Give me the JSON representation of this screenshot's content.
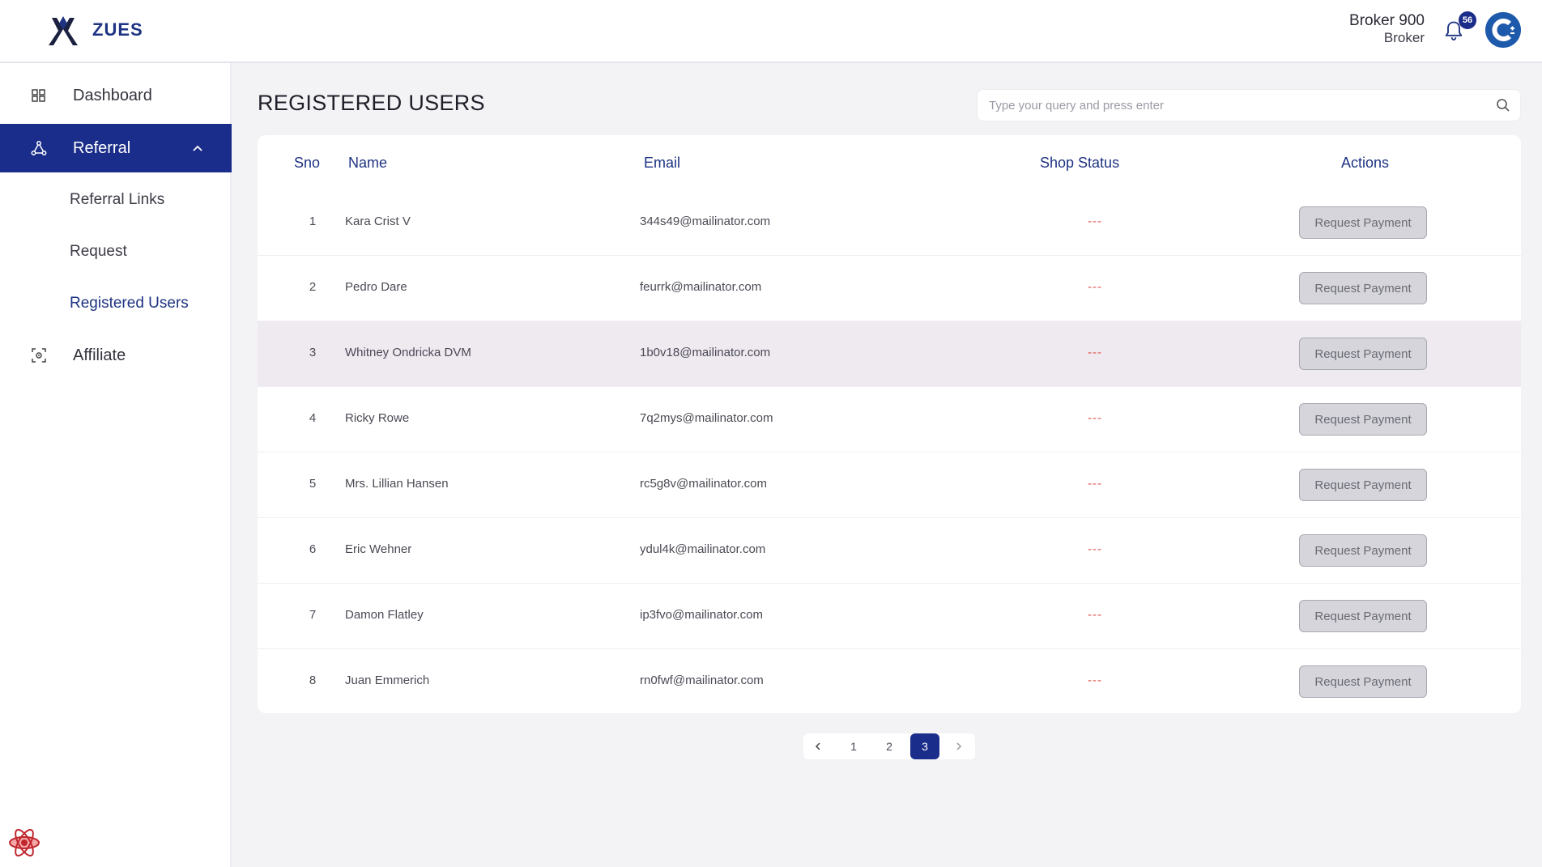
{
  "app": {
    "brand": "ZUES"
  },
  "user": {
    "name": "Broker 900",
    "role": "Broker",
    "notifications": "56"
  },
  "sidebar": {
    "items": [
      {
        "label": "Dashboard",
        "icon": "grid-icon"
      },
      {
        "label": "Referral",
        "icon": "referral-network-icon"
      },
      {
        "label": "Referral Links"
      },
      {
        "label": "Request"
      },
      {
        "label": "Registered Users"
      },
      {
        "label": "Affiliate",
        "icon": "affiliate-frame-icon"
      }
    ]
  },
  "page": {
    "title": "REGISTERED USERS"
  },
  "search": {
    "placeholder": "Type your query and press enter"
  },
  "table": {
    "headers": {
      "sno": "Sno",
      "name": "Name",
      "email": "Email",
      "status": "Shop Status",
      "actions": "Actions"
    },
    "action_label": "Request Payment",
    "rows": [
      {
        "sno": "1",
        "name": "Kara Crist V",
        "email": "344s49@mailinator.com",
        "status": "---"
      },
      {
        "sno": "2",
        "name": "Pedro Dare",
        "email": "feurrk@mailinator.com",
        "status": "---"
      },
      {
        "sno": "3",
        "name": "Whitney Ondricka DVM",
        "email": "1b0v18@mailinator.com",
        "status": "---"
      },
      {
        "sno": "4",
        "name": "Ricky Rowe",
        "email": "7q2mys@mailinator.com",
        "status": "---"
      },
      {
        "sno": "5",
        "name": "Mrs. Lillian Hansen",
        "email": "rc5g8v@mailinator.com",
        "status": "---"
      },
      {
        "sno": "6",
        "name": "Eric Wehner",
        "email": "ydul4k@mailinator.com",
        "status": "---"
      },
      {
        "sno": "7",
        "name": "Damon Flatley",
        "email": "ip3fvo@mailinator.com",
        "status": "---"
      },
      {
        "sno": "8",
        "name": "Juan Emmerich",
        "email": "rn0fwf@mailinator.com",
        "status": "---"
      }
    ]
  },
  "pagination": {
    "pages": [
      "1",
      "2",
      "3"
    ],
    "current": "3"
  },
  "colors": {
    "primary": "#1b2d8a",
    "accent_text": "#1e3382",
    "status_empty": "#e0534d",
    "row_highlight": "#efe9f0"
  }
}
